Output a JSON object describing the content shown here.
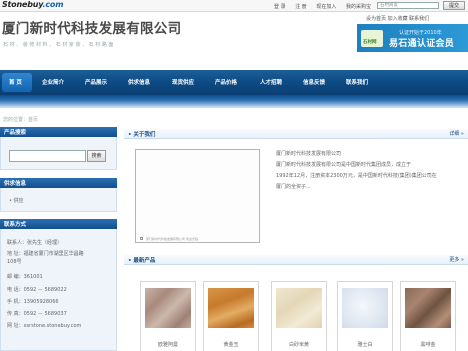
{
  "site": {
    "logo_text": "Stonebuy",
    "logo_suffix": ".com",
    "top_links": [
      "登 录",
      "注 册",
      "现在加入",
      "我的采购宝"
    ],
    "top_search_placeholder": "石材商友",
    "top_search_button": "提交"
  },
  "header": {
    "company_name": "厦门新时代科技发展有限公司",
    "subtitle": "石 材 、 装 修 材 料 、 石 材 家 装 、 石 材 路 面",
    "vip_links": "设为首页  加入收藏  联系我们",
    "promo_badge": "石材网",
    "promo_line1": "认证开始于2010年",
    "promo_line2": "易石通认证会员"
  },
  "nav": {
    "items": [
      "首 页",
      "企业简介",
      "产品展示",
      "供求信息",
      "现货供应",
      "产品价格",
      "人才招聘",
      "信息反馈",
      "联系我们"
    ]
  },
  "breadcrumb": "您的位置：首页",
  "sidebar": {
    "search_title": "产品搜索",
    "search_button": "搜索",
    "supply_title": "供求信息",
    "supply_items": [
      "• 供应"
    ],
    "contact_title": "联系方式",
    "contact_rows": [
      "联系人：张先生（经理）",
      "地    址：福建省厦门市湖里区华昌路",
      "             108号",
      "邮    编：361001",
      "电    话：0592 － 5689022",
      "手    机：13905928066",
      "传    真：0592 － 5689037",
      "网    址：xsrstone.stonebuy.com"
    ]
  },
  "about": {
    "title": "• 关于我们",
    "more": "详细 »",
    "caption": "厦门新时代科技发展有限公司 欢迎光临",
    "lines": [
      "厦门新时代科技发展有限公司",
      "      厦门新时代科技发展有限公司是中国新时代集团成员，成立于",
      "1992年12月，注册资本2300万元，是中国新时代科技(集团)集团公司在",
      "厦门的全资子..."
    ]
  },
  "products": {
    "title": "• 最新产品",
    "more": "更多 »",
    "items": [
      {
        "name": "欧雅阿曼"
      },
      {
        "name": "黄金玉"
      },
      {
        "name": "白砂米黄"
      },
      {
        "name": "雅士白"
      },
      {
        "name": "黑啡金"
      }
    ]
  },
  "colors": {
    "nav_blue": "#0d4a84",
    "panel_blue": "#134f8c",
    "title_gray": "#4a4a4a"
  }
}
